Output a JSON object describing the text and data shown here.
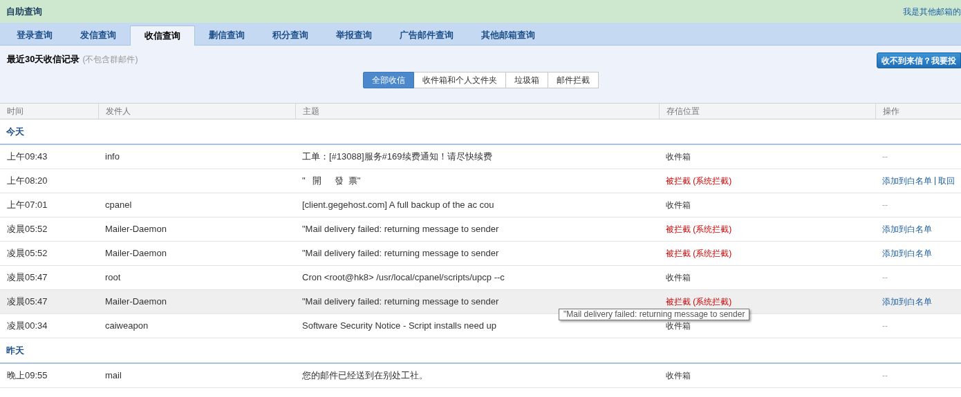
{
  "header": {
    "title": "自助查询",
    "link": "我是其他邮箱的"
  },
  "tabs": [
    {
      "label": "登录查询",
      "selected": false
    },
    {
      "label": "发信查询",
      "selected": false
    },
    {
      "label": "收信查询",
      "selected": true
    },
    {
      "label": "删信查询",
      "selected": false
    },
    {
      "label": "积分查询",
      "selected": false
    },
    {
      "label": "举报查询",
      "selected": false
    },
    {
      "label": "广告邮件查询",
      "selected": false
    },
    {
      "label": "其他邮箱查询",
      "selected": false
    }
  ],
  "section": {
    "title": "最近30天收信记录",
    "note": "(不包含群邮件)",
    "report_button": "收不到来信？我要投"
  },
  "filters": [
    {
      "label": "全部收信",
      "selected": true
    },
    {
      "label": "收件箱和个人文件夹",
      "selected": false
    },
    {
      "label": "垃圾箱",
      "selected": false
    },
    {
      "label": "邮件拦截",
      "selected": false
    }
  ],
  "table": {
    "columns": [
      "时间",
      "发件人",
      "主题",
      "存信位置",
      "操作"
    ],
    "groups": [
      {
        "label": "今天",
        "rows": [
          {
            "time": "上午09:43",
            "sender": "info",
            "subject": "工单：[#13088]服务#169续费通知！请尽快续费",
            "location": "收件箱",
            "blocked": false,
            "highlighted": false,
            "actions": [],
            "empty_action": "--"
          },
          {
            "time": "上午08:20",
            "sender": "",
            "subject": "\"   開     發  票\"",
            "location": "被拦截 (系统拦截)",
            "blocked": true,
            "highlighted": false,
            "actions": [
              "添加到白名单",
              "取回"
            ]
          },
          {
            "time": "上午07:01",
            "sender": "cpanel",
            "subject": "[client.gegehost.com] A full backup of the ac cou",
            "location": "收件箱",
            "blocked": false,
            "highlighted": false,
            "actions": [],
            "empty_action": "--"
          },
          {
            "time": "凌晨05:52",
            "sender": "Mailer-Daemon",
            "subject": "\"Mail delivery failed: returning message to sender",
            "location": "被拦截 (系统拦截)",
            "blocked": true,
            "highlighted": false,
            "actions": [
              "添加到白名单"
            ]
          },
          {
            "time": "凌晨05:52",
            "sender": "Mailer-Daemon",
            "subject": "\"Mail delivery failed: returning message to sender",
            "location": "被拦截 (系统拦截)",
            "blocked": true,
            "highlighted": false,
            "actions": [
              "添加到白名单"
            ]
          },
          {
            "time": "凌晨05:47",
            "sender": "root",
            "subject": "Cron <root@hk8> /usr/local/cpanel/scripts/upcp --c",
            "location": "收件箱",
            "blocked": false,
            "highlighted": false,
            "actions": [],
            "empty_action": "--"
          },
          {
            "time": "凌晨05:47",
            "sender": "Mailer-Daemon",
            "subject": "\"Mail delivery failed: returning message to sender",
            "location": "被拦截 (系统拦截)",
            "blocked": true,
            "highlighted": true,
            "actions": [
              "添加到白名单"
            ]
          },
          {
            "time": "凌晨00:34",
            "sender": "caiweapon",
            "subject": "Software Security Notice - Script installs need up",
            "location": "收件箱",
            "blocked": false,
            "highlighted": false,
            "actions": [],
            "empty_action": "--"
          }
        ]
      },
      {
        "label": "昨天",
        "rows": [
          {
            "time": "晚上09:55",
            "sender": "mail",
            "subject": "您的邮件已经送到在别处工社。",
            "location": "收件箱",
            "blocked": false,
            "highlighted": false,
            "actions": [],
            "empty_action": "--"
          }
        ]
      }
    ]
  },
  "tooltip": "\"Mail delivery failed: returning message to sender"
}
